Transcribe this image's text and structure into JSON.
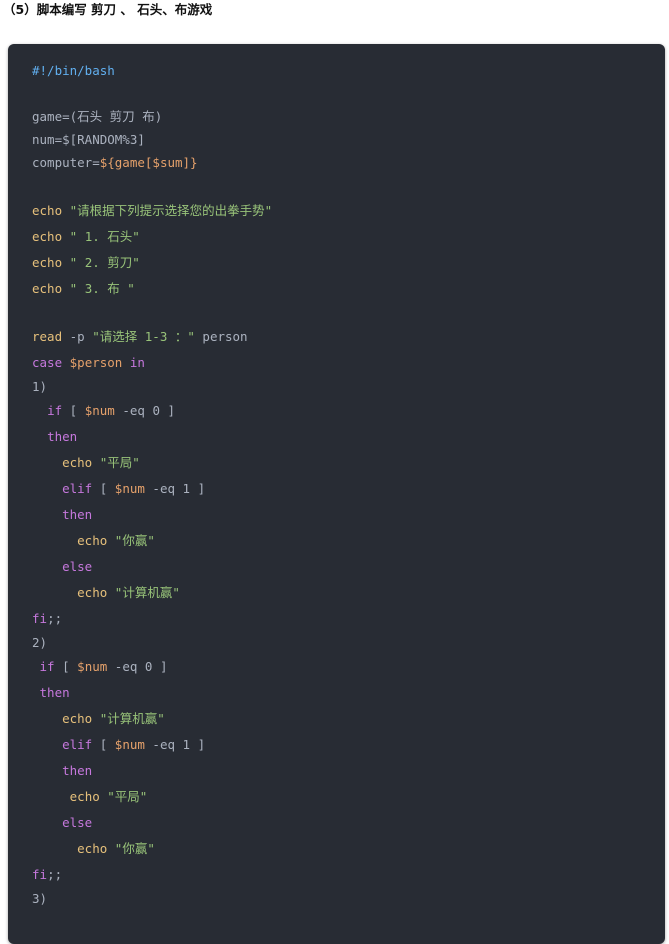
{
  "heading": "（5）脚本编写 剪刀 、 石头、布游戏",
  "code_lines": [
    {
      "tokens": [
        {
          "t": "#!/bin/bash",
          "c": "meta"
        }
      ]
    },
    {
      "tokens": []
    },
    {
      "tokens": [
        {
          "t": "game=(石头 剪刀 布)",
          "c": "plain"
        }
      ]
    },
    {
      "tokens": [
        {
          "t": "num=$[RANDOM%3]",
          "c": "plain"
        }
      ]
    },
    {
      "tokens": [
        {
          "t": "computer=",
          "c": "plain"
        },
        {
          "t": "${game[$sum]}",
          "c": "var"
        }
      ]
    },
    {
      "tokens": []
    },
    {
      "tokens": [
        {
          "t": "echo",
          "c": "builtin"
        },
        {
          "t": " ",
          "c": "plain"
        },
        {
          "t": "\"请根据下列提示选择您的出拳手势\"",
          "c": "str"
        }
      ]
    },
    {
      "tokens": [
        {
          "t": "echo",
          "c": "builtin"
        },
        {
          "t": " ",
          "c": "plain"
        },
        {
          "t": "\" 1. 石头\"",
          "c": "str"
        }
      ]
    },
    {
      "tokens": [
        {
          "t": "echo",
          "c": "builtin"
        },
        {
          "t": " ",
          "c": "plain"
        },
        {
          "t": "\" 2. 剪刀\"",
          "c": "str"
        }
      ]
    },
    {
      "tokens": [
        {
          "t": "echo",
          "c": "builtin"
        },
        {
          "t": " ",
          "c": "plain"
        },
        {
          "t": "\" 3. 布 \"",
          "c": "str"
        }
      ]
    },
    {
      "tokens": []
    },
    {
      "tokens": [
        {
          "t": "read",
          "c": "builtin"
        },
        {
          "t": " -p ",
          "c": "plain"
        },
        {
          "t": "\"请选择 1-3 ：\"",
          "c": "str"
        },
        {
          "t": " person",
          "c": "plain"
        }
      ]
    },
    {
      "tokens": [
        {
          "t": "case",
          "c": "kw"
        },
        {
          "t": " ",
          "c": "plain"
        },
        {
          "t": "$person",
          "c": "var"
        },
        {
          "t": " ",
          "c": "plain"
        },
        {
          "t": "in",
          "c": "kw"
        }
      ]
    },
    {
      "tokens": [
        {
          "t": "1)",
          "c": "plain"
        }
      ]
    },
    {
      "tokens": [
        {
          "t": "  ",
          "c": "plain"
        },
        {
          "t": "if",
          "c": "kw"
        },
        {
          "t": " [ ",
          "c": "plain"
        },
        {
          "t": "$num",
          "c": "var"
        },
        {
          "t": " -eq 0 ]",
          "c": "plain"
        }
      ]
    },
    {
      "tokens": [
        {
          "t": "  ",
          "c": "plain"
        },
        {
          "t": "then",
          "c": "kw"
        }
      ]
    },
    {
      "tokens": [
        {
          "t": "    ",
          "c": "plain"
        },
        {
          "t": "echo",
          "c": "builtin"
        },
        {
          "t": " ",
          "c": "plain"
        },
        {
          "t": "\"平局\"",
          "c": "str"
        }
      ]
    },
    {
      "tokens": [
        {
          "t": "    ",
          "c": "plain"
        },
        {
          "t": "elif",
          "c": "kw"
        },
        {
          "t": " [ ",
          "c": "plain"
        },
        {
          "t": "$num",
          "c": "var"
        },
        {
          "t": " -eq 1 ]",
          "c": "plain"
        }
      ]
    },
    {
      "tokens": [
        {
          "t": "    ",
          "c": "plain"
        },
        {
          "t": "then",
          "c": "kw"
        }
      ]
    },
    {
      "tokens": [
        {
          "t": "      ",
          "c": "plain"
        },
        {
          "t": "echo",
          "c": "builtin"
        },
        {
          "t": " ",
          "c": "plain"
        },
        {
          "t": "\"你赢\"",
          "c": "str"
        }
      ]
    },
    {
      "tokens": [
        {
          "t": "    ",
          "c": "plain"
        },
        {
          "t": "else",
          "c": "kw"
        }
      ]
    },
    {
      "tokens": [
        {
          "t": "      ",
          "c": "plain"
        },
        {
          "t": "echo",
          "c": "builtin"
        },
        {
          "t": " ",
          "c": "plain"
        },
        {
          "t": "\"计算机赢\"",
          "c": "str"
        }
      ]
    },
    {
      "tokens": [
        {
          "t": "fi",
          "c": "kw"
        },
        {
          "t": ";;",
          "c": "plain"
        }
      ]
    },
    {
      "tokens": [
        {
          "t": "2)",
          "c": "plain"
        }
      ]
    },
    {
      "tokens": [
        {
          "t": " ",
          "c": "plain"
        },
        {
          "t": "if",
          "c": "kw"
        },
        {
          "t": " [ ",
          "c": "plain"
        },
        {
          "t": "$num",
          "c": "var"
        },
        {
          "t": " -eq 0 ]",
          "c": "plain"
        }
      ]
    },
    {
      "tokens": [
        {
          "t": " ",
          "c": "plain"
        },
        {
          "t": "then",
          "c": "kw"
        }
      ]
    },
    {
      "tokens": [
        {
          "t": "    ",
          "c": "plain"
        },
        {
          "t": "echo",
          "c": "builtin"
        },
        {
          "t": " ",
          "c": "plain"
        },
        {
          "t": "\"计算机赢\"",
          "c": "str"
        }
      ]
    },
    {
      "tokens": [
        {
          "t": "    ",
          "c": "plain"
        },
        {
          "t": "elif",
          "c": "kw"
        },
        {
          "t": " [ ",
          "c": "plain"
        },
        {
          "t": "$num",
          "c": "var"
        },
        {
          "t": " -eq 1 ]",
          "c": "plain"
        }
      ]
    },
    {
      "tokens": [
        {
          "t": "    ",
          "c": "plain"
        },
        {
          "t": "then",
          "c": "kw"
        }
      ]
    },
    {
      "tokens": [
        {
          "t": "     ",
          "c": "plain"
        },
        {
          "t": "echo",
          "c": "builtin"
        },
        {
          "t": " ",
          "c": "plain"
        },
        {
          "t": "\"平局\"",
          "c": "str"
        }
      ]
    },
    {
      "tokens": [
        {
          "t": "    ",
          "c": "plain"
        },
        {
          "t": "else",
          "c": "kw"
        }
      ]
    },
    {
      "tokens": [
        {
          "t": "      ",
          "c": "plain"
        },
        {
          "t": "echo",
          "c": "builtin"
        },
        {
          "t": " ",
          "c": "plain"
        },
        {
          "t": "\"你赢\"",
          "c": "str"
        }
      ]
    },
    {
      "tokens": [
        {
          "t": "fi",
          "c": "kw"
        },
        {
          "t": ";;",
          "c": "plain"
        }
      ]
    },
    {
      "tokens": [
        {
          "t": "3)",
          "c": "plain"
        }
      ]
    }
  ],
  "colors": {
    "background": "#282c34",
    "plain": "#abb2bf",
    "keyword": "#c678dd",
    "builtin": "#e6c07b",
    "string": "#98c379",
    "variable": "#e5a16b",
    "shebang": "#61afef"
  }
}
